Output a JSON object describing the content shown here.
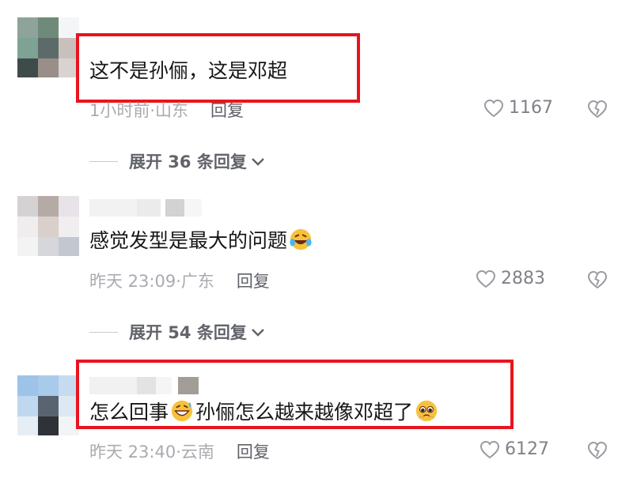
{
  "comments": [
    {
      "text": "这不是孙俪，这是邓超",
      "time": "1小时前·山东",
      "reply_label": "回复",
      "likes": "1167",
      "highlighted": true,
      "avatar_icon": "blurred-avatar"
    },
    {
      "text_before_emoji": "感觉发型是最大的问题",
      "text_after_emoji": "",
      "emoji": "laughing-crying-emoji",
      "time": "昨天 23:09·广东",
      "reply_label": "回复",
      "likes": "2883",
      "highlighted": false,
      "avatar_icon": "blurred-avatar"
    },
    {
      "text_before_emoji": "怎么回事",
      "text_after_emoji": "孙俪怎么越来越像邓超了",
      "emoji": "grinning-sweat-emoji",
      "emoji_end": "pleading-emoji",
      "time": "昨天 23:40·云南",
      "reply_label": "回复",
      "likes": "6127",
      "highlighted": true,
      "avatar_icon": "blurred-avatar"
    }
  ],
  "expand_replies": [
    {
      "label": "展开 36 条回复"
    },
    {
      "label": "展开 54 条回复"
    }
  ],
  "colors": {
    "highlight_border": "#e8141e",
    "meta_text": "#a9abb0",
    "reply_text": "#5f6169"
  }
}
